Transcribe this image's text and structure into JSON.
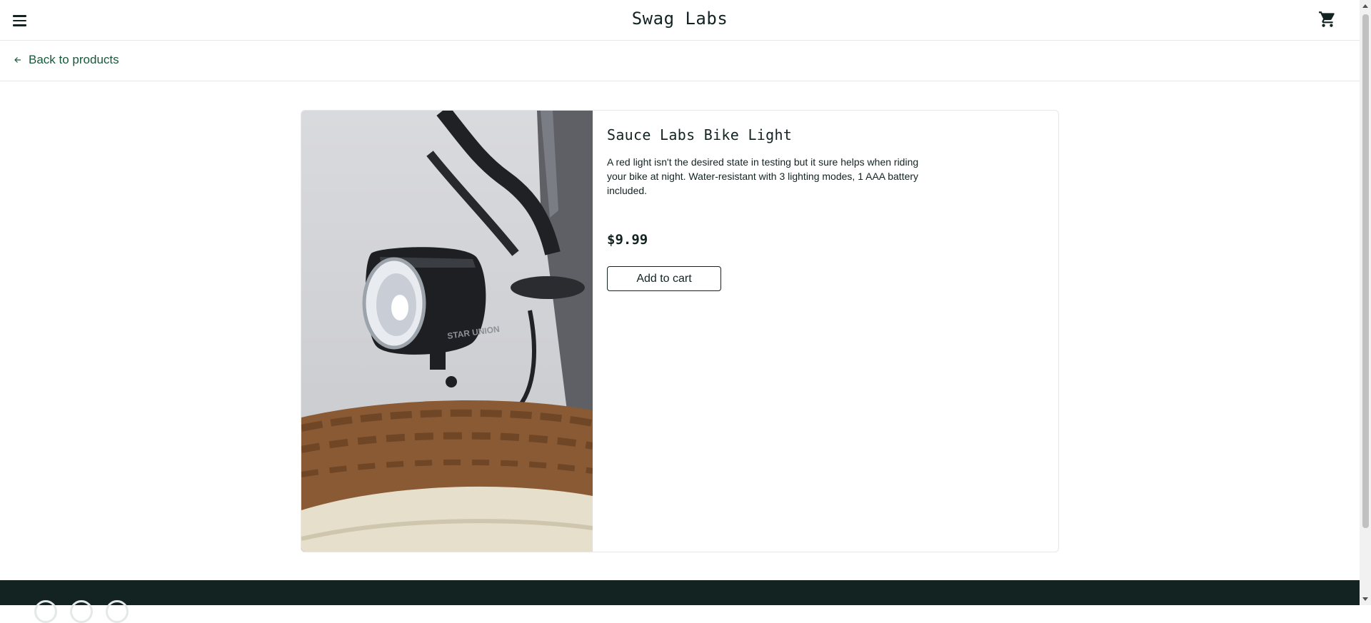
{
  "header": {
    "title": "Swag Labs",
    "menu_icon": "hamburger-menu-icon",
    "cart_icon": "shopping-cart-icon"
  },
  "subheader": {
    "back_label": "Back to products",
    "back_icon": "arrow-left-icon"
  },
  "product": {
    "name": "Sauce Labs Bike Light",
    "description": "A red light isn't the desired state in testing but it sure helps when riding your bike at night. Water-resistant with 3 lighting modes, 1 AAA battery included.",
    "price": "$9.99",
    "add_to_cart_label": "Add to cart",
    "image_brand_text": "STAR UNION"
  },
  "colors": {
    "brand_text": "#132322",
    "link": "#18583a",
    "footer": "#132322",
    "border": "#e5e8e8"
  }
}
